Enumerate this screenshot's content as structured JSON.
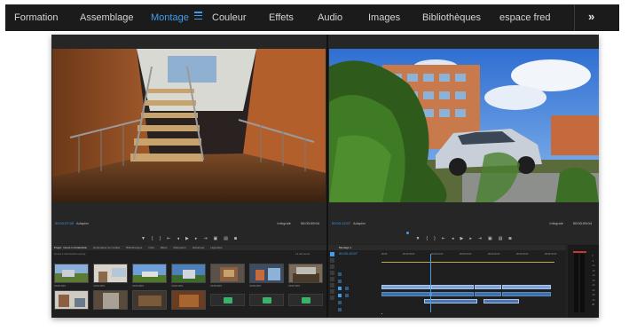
{
  "workspaces": {
    "items": [
      "Formation",
      "Assemblage",
      "Montage",
      "Couleur",
      "Effets",
      "Audio",
      "Images",
      "Bibliothèques",
      "espace fred"
    ],
    "active": "Montage",
    "more_label": "»"
  },
  "source_monitor": {
    "timecode": "00:00:07:00",
    "fit": "Adapter",
    "full_res": "Intégrale",
    "duration": "00:00:09:04"
  },
  "program_monitor": {
    "timecode": "00:00:13:07",
    "fit": "Adapter",
    "full_res": "Intégrale",
    "duration": "00:00:09:04"
  },
  "transport_icons": [
    "marker-in",
    "mark-in",
    "mark-out",
    "go-to-in",
    "step-back",
    "play",
    "step-forward",
    "go-to-out",
    "insert",
    "overwrite",
    "export-frame"
  ],
  "project_panel": {
    "tabs": [
      "Projet : Cours 1 introduction",
      "Explorateur de médias",
      "Bibliothèques",
      "Infos",
      "Effets",
      "Marqueurs",
      "Historique",
      "Légendes"
    ],
    "path": "Cours 1 introduction.prproj",
    "item_count": "11 éléments",
    "thumb_captions": [
      "C0001.MP4",
      "C0002.MP4",
      "C0003.MP4",
      "C0004.MP4",
      "C0005.MP4",
      "C0006.MP4",
      "C0007.MP4"
    ]
  },
  "timeline": {
    "tab": "Montage 1",
    "timecode": "00:00:15:07",
    "ruler": [
      "00:00",
      "00:00:05:00",
      "00:00:10:00",
      "00:00:15:00",
      "00:00:20:00",
      "00:00:25:00",
      "00:00:30:00"
    ],
    "tracks": [
      "V3",
      "V2",
      "V1",
      "A1",
      "A2",
      "A3"
    ]
  },
  "meters": {
    "scale": [
      "0",
      "-6",
      "-12",
      "-18",
      "-24",
      "-30",
      "-36",
      "-42",
      "-48",
      "-54",
      "dB"
    ]
  },
  "colors": {
    "accent": "#3f9df0",
    "clip_video": "#7fa3d6",
    "clip_audio": "#3f6fa8",
    "audio_wave": "#39b36a",
    "peak": "#c03a2b"
  }
}
